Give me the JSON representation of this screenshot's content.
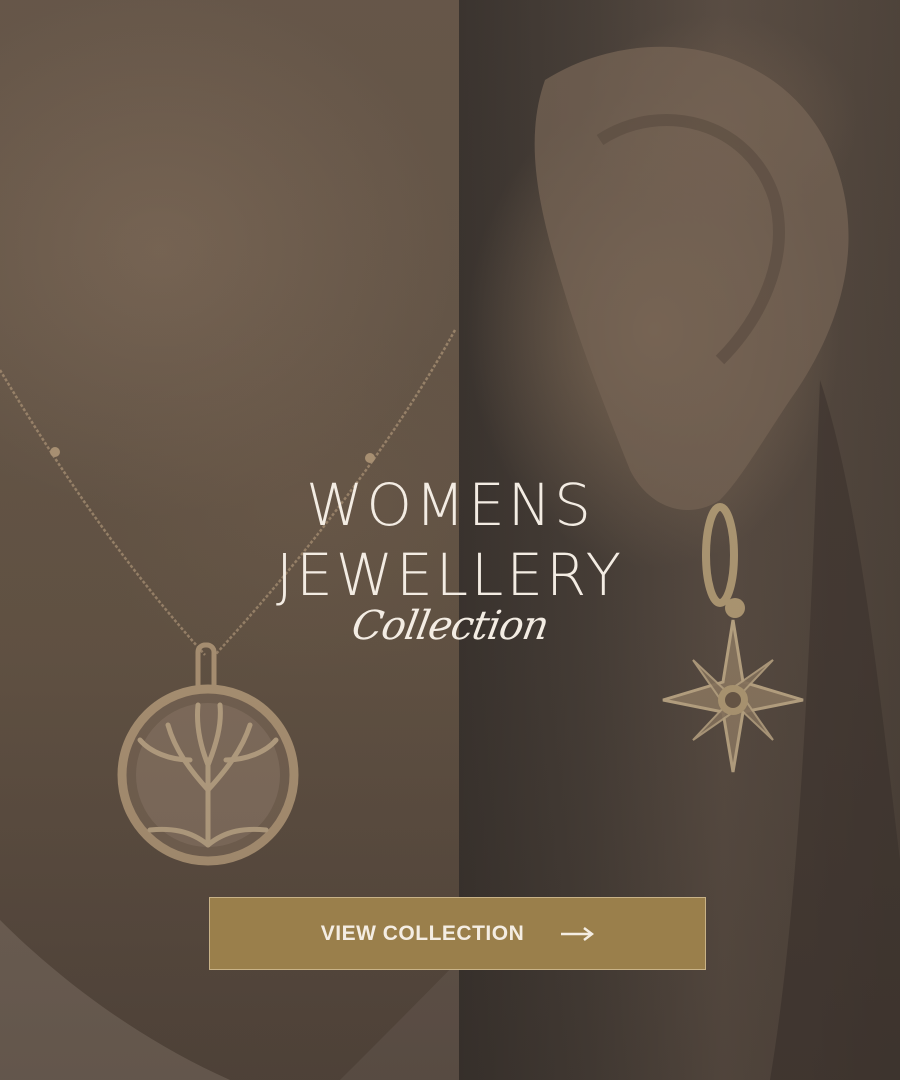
{
  "hero": {
    "title_line1": "WOMENS",
    "title_line2": "JEWELLERY",
    "script_word": "Collection"
  },
  "cta": {
    "label": "VIEW COLLECTION",
    "icon": "arrow-right-icon"
  },
  "images": {
    "left": "necklace-photo",
    "right": "earring-photo"
  },
  "colors": {
    "button": "#9a7f4b",
    "text": "#f3ece3",
    "overlay": "#3a332d"
  }
}
